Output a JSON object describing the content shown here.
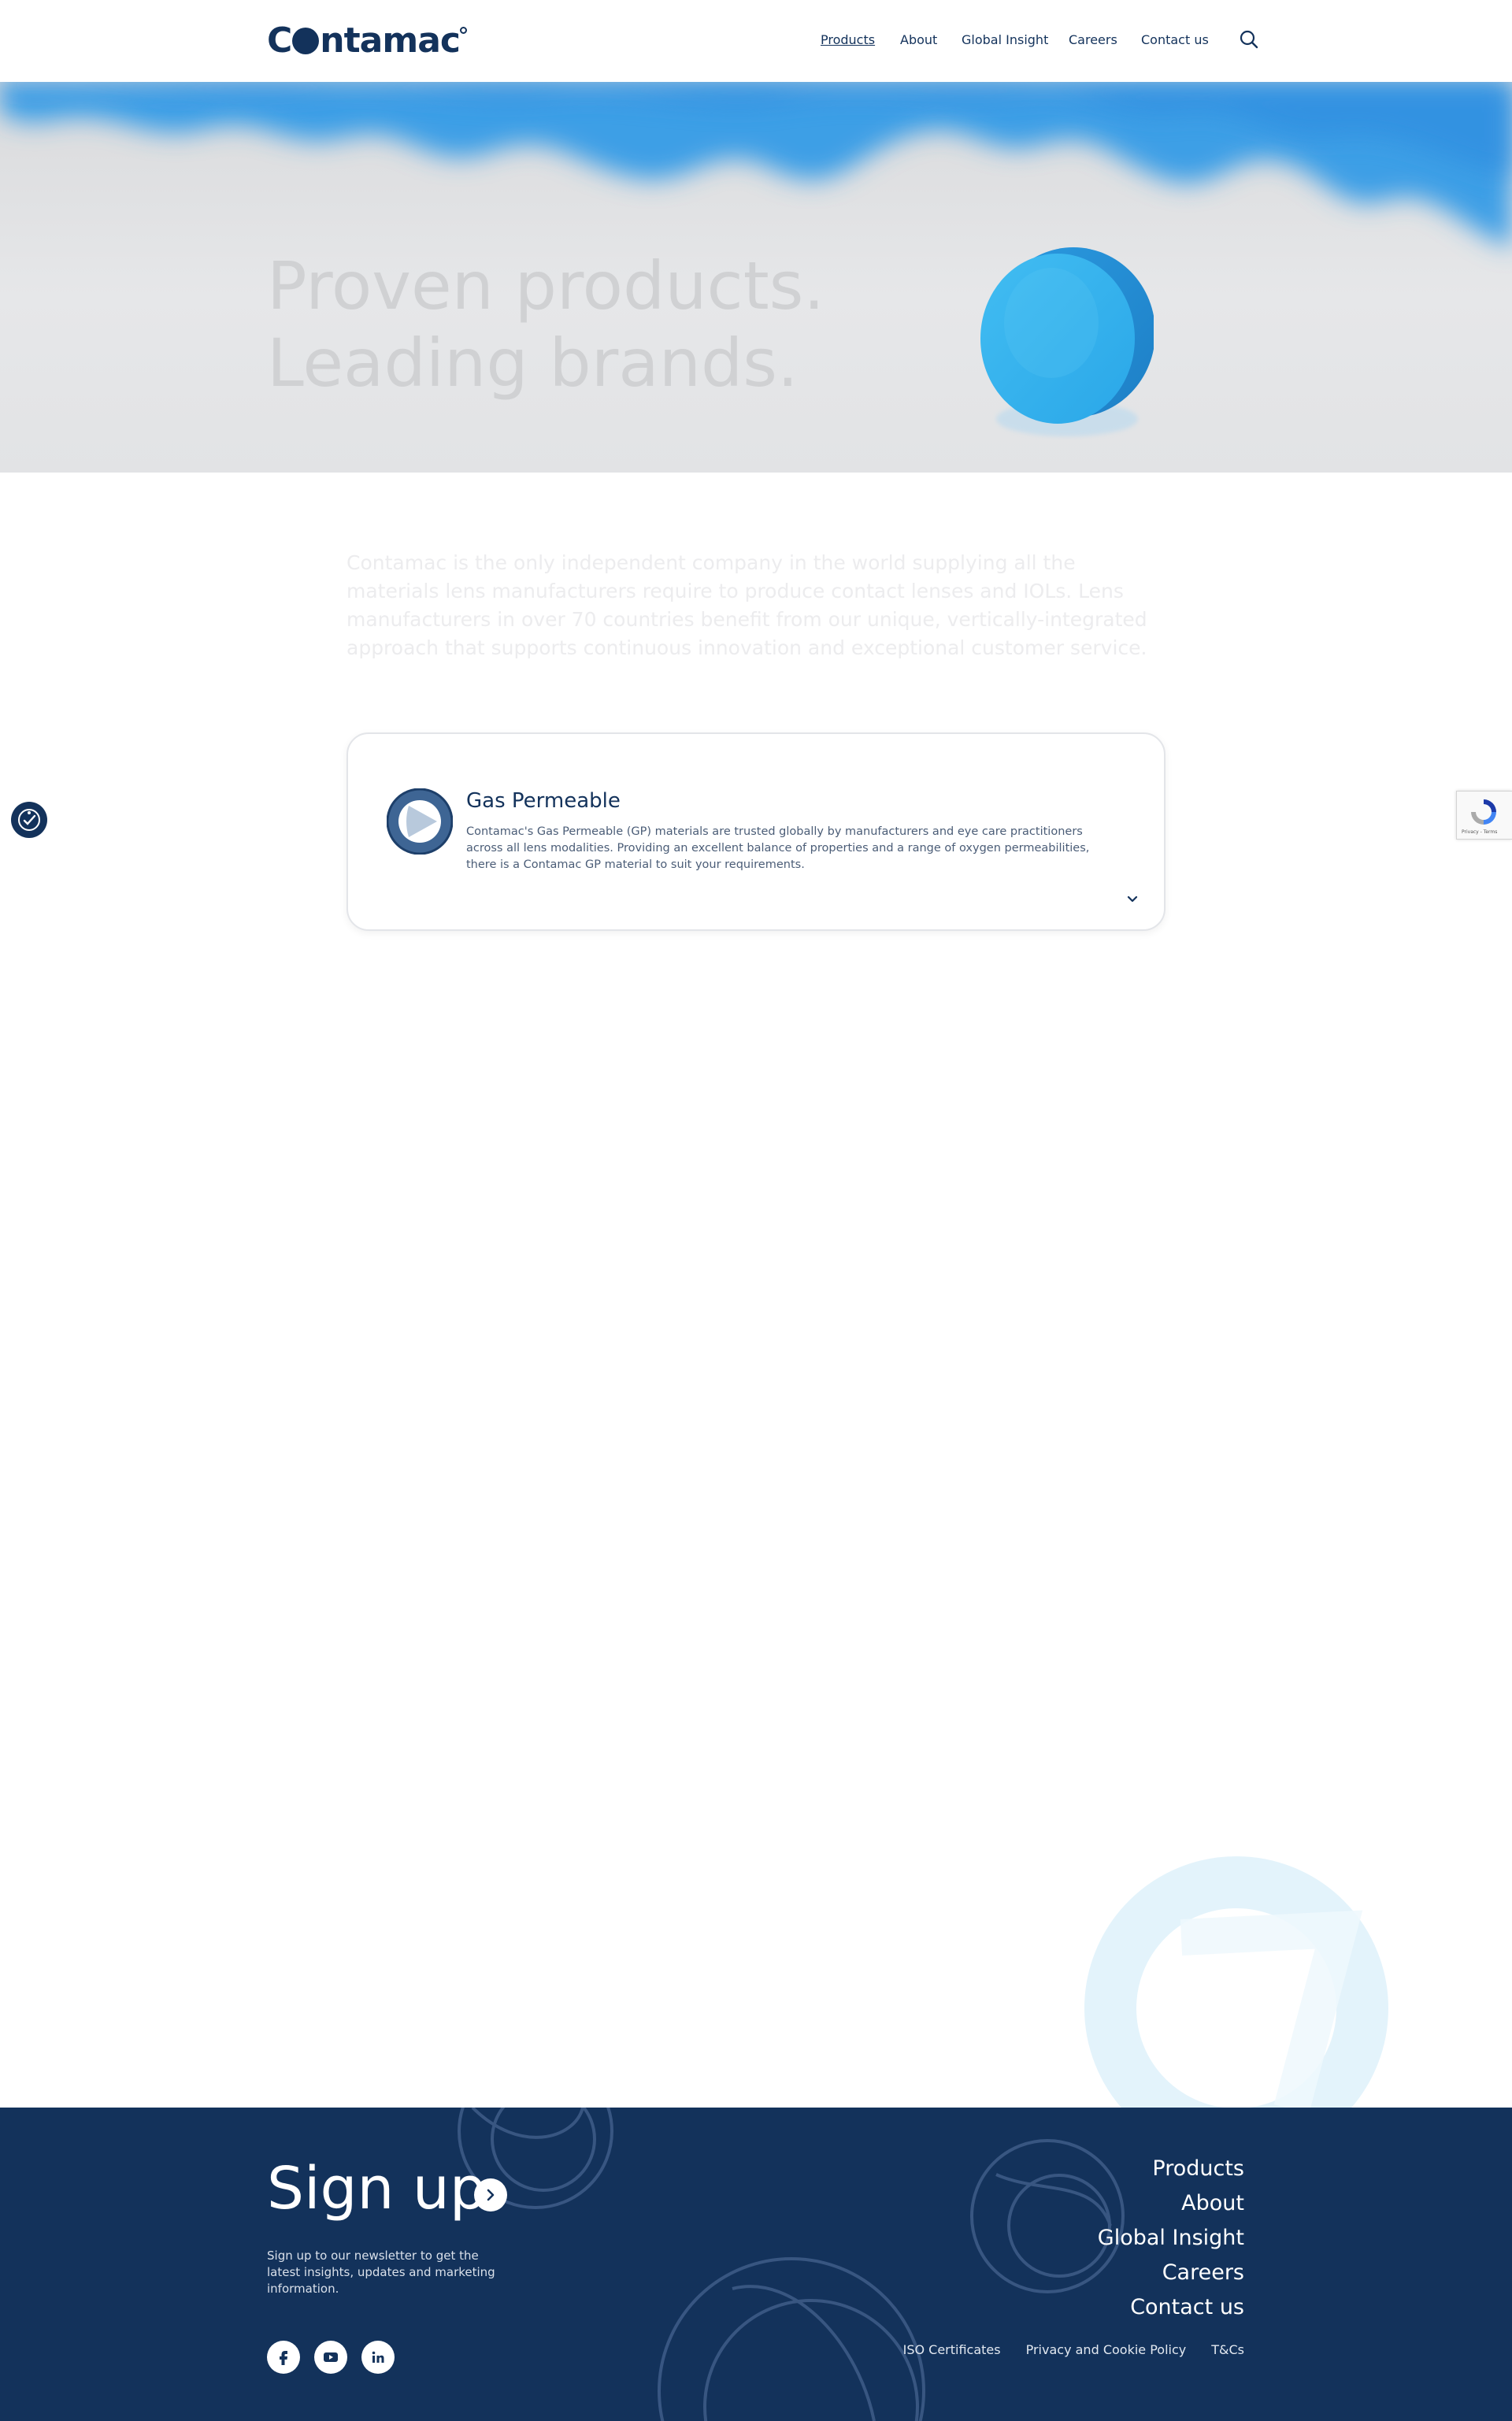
{
  "header": {
    "logo_text": "Contamac",
    "nav": [
      {
        "label": "Products",
        "active": true
      },
      {
        "label": "About"
      },
      {
        "label": "Global Insight"
      },
      {
        "label": "Careers"
      },
      {
        "label": "Contact us"
      }
    ],
    "search_icon": "search-icon"
  },
  "hero": {
    "title_line1": "Proven products.",
    "title_line2": "Leading brands."
  },
  "intro": {
    "text": "Contamac is the only independent company in the world supplying all the materials lens manufacturers require to produce contact lenses and IOLs. Lens manufacturers in over 70 countries benefit from our unique, vertically-integrated approach that supports continuous innovation and exceptional customer service."
  },
  "card": {
    "title": "Gas Permeable",
    "description": "Contamac's Gas Permeable (GP) materials are trusted globally by manufacturers and eye care practitioners across all lens modalities. Providing an excellent balance of properties and a range of oxygen permeabilities, there is a Contamac GP material to suit your requirements.",
    "icon": "gas-permeable-icon",
    "toggle_icon": "chevron-down-icon"
  },
  "widgets": {
    "accessibility_icon": "accessibility-icon",
    "recaptcha_text": "Privacy - Terms"
  },
  "footer": {
    "signup_title": "Sign up",
    "signup_desc": "Sign up to our newsletter to get the latest insights, updates and marketing information.",
    "social": [
      "facebook-icon",
      "youtube-icon",
      "linkedin-icon"
    ],
    "nav": [
      "Products",
      "About",
      "Global Insight",
      "Careers",
      "Contact us"
    ],
    "legal": [
      "ISO Certificates",
      "Privacy and Cookie Policy",
      "T&Cs"
    ]
  },
  "colors": {
    "brand_navy": "#13325b",
    "accent_blue": "#3aa2e6",
    "white": "#ffffff"
  }
}
